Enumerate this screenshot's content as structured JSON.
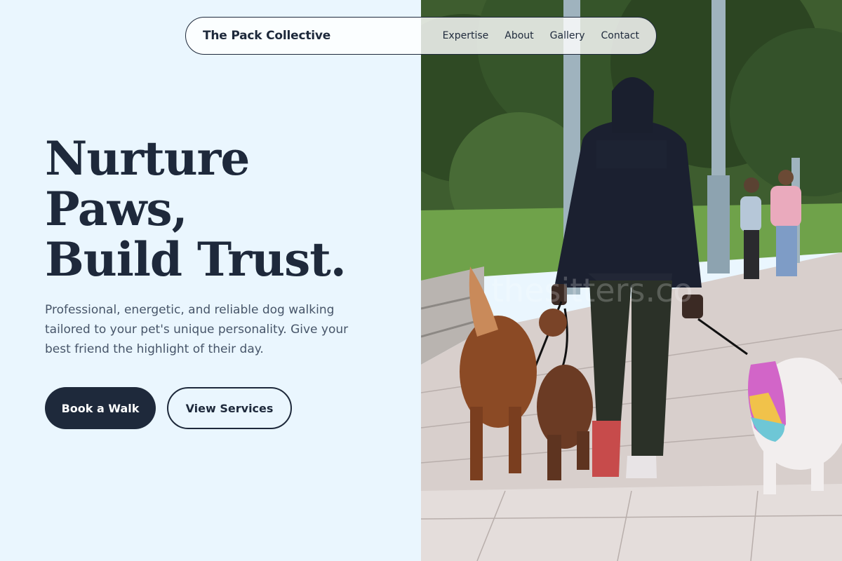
{
  "nav": {
    "brand": "The Pack Collective",
    "links": [
      "Expertise",
      "About",
      "Gallery",
      "Contact"
    ]
  },
  "hero": {
    "headline_lines": [
      "Nurture",
      "Paws,",
      "Build Trust."
    ],
    "description": "Professional, energetic, and reliable dog walking tailored to your pet's unique personality. Give your best friend the highlight of their day.",
    "primary_cta": "Book a Walk",
    "secondary_cta": "View Services"
  },
  "photo": {
    "watermark": "thesitters.co"
  },
  "colors": {
    "background": "#eaf6fe",
    "primary": "#1e293b",
    "body_text": "#475569"
  }
}
